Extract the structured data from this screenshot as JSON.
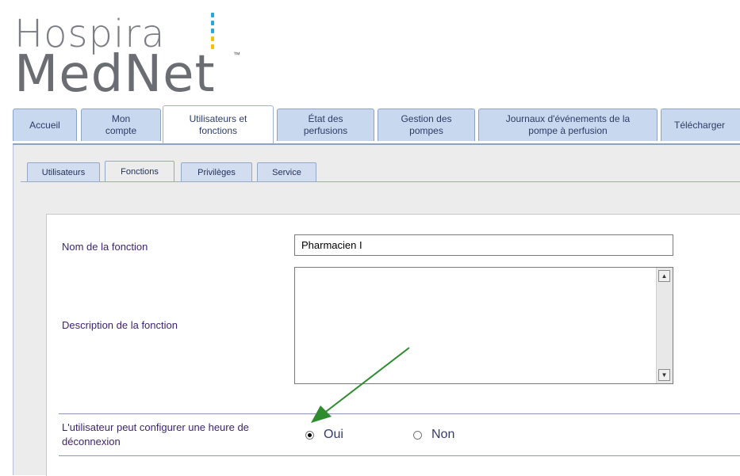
{
  "logo": {
    "line1": "Hospira",
    "line2": "MedNet",
    "tm": "™"
  },
  "main_tabs": [
    {
      "label": "Accueil"
    },
    {
      "label": "Mon compte"
    },
    {
      "label": "Utilisateurs et fonctions"
    },
    {
      "label": "État des perfusions"
    },
    {
      "label": "Gestion des pompes"
    },
    {
      "label": "Journaux d'événements de la pompe à perfusion"
    },
    {
      "label": "Télécharger"
    }
  ],
  "active_main_tab": "Utilisateurs et fonctions",
  "sub_tabs": [
    {
      "label": "Utilisateurs"
    },
    {
      "label": "Fonctions"
    },
    {
      "label": "Privilèges"
    },
    {
      "label": "Service"
    }
  ],
  "active_sub_tab": "Fonctions",
  "form": {
    "role_name_label": "Nom de la fonction",
    "role_name_value": "Pharmacien I",
    "description_label": "Description de la fonction",
    "description_value": "",
    "logout_label": "L'utilisateur peut configurer une heure de déconnexion",
    "options": [
      {
        "label": "Oui",
        "selected": true
      },
      {
        "label": "Non",
        "selected": false
      }
    ]
  },
  "colors": {
    "tab_bg": "#c8d8ee",
    "tab_text": "#2c3d66",
    "label_text": "#3c2470",
    "annotation_arrow": "#2e8b2e"
  }
}
